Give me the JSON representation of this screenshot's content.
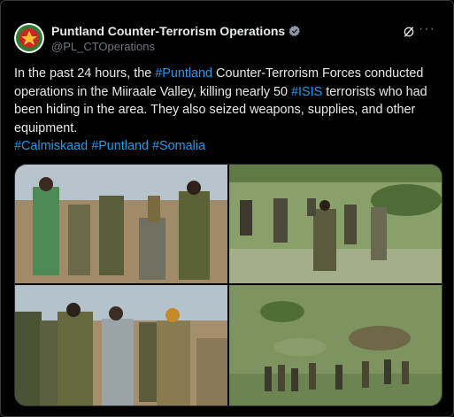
{
  "post": {
    "author": {
      "display_name": "Puntland Counter-Terrorism Operations",
      "handle": "@PL_CTOperations",
      "verified": true,
      "verified_icon": "verified-badge-icon"
    },
    "text": {
      "part1": "In the past 24 hours, the ",
      "tag1": "#Puntland",
      "part2": " Counter-Terrorism Forces conducted operations in the Miiraale Valley, killing nearly 50 ",
      "tag2": "#ISIS",
      "part3": " terrorists who had been hiding in the area. They also seized weapons, supplies, and other equipment.",
      "hashtags": [
        "#Calmiskaad",
        "#Puntland",
        "#Somalia"
      ]
    },
    "actions": {
      "grok_icon": "grok-icon",
      "more_label": "···"
    },
    "colors": {
      "link": "#1d9bf0",
      "background": "#000000",
      "text": "#e7e9ea",
      "muted": "#71767b"
    }
  }
}
